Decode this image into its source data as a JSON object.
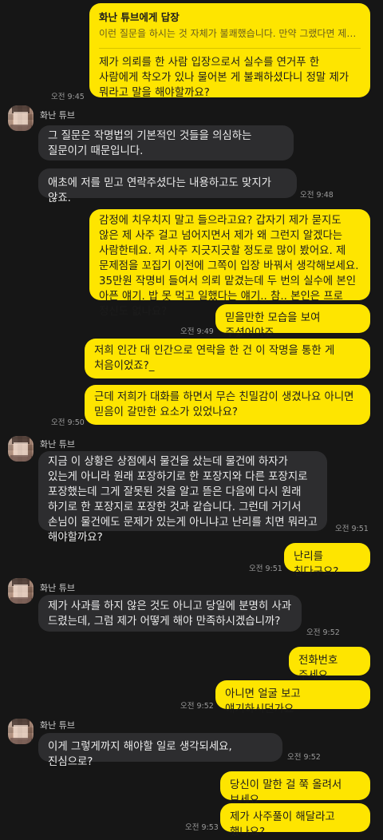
{
  "sender_name": "화난 튜브",
  "messages": [
    {
      "id": "m1",
      "side": "mine",
      "reply_title": "화난 튜브에게 답장",
      "reply_quote": "이런 질문을 하시는 것 자체가 불쾌했습니다. 만약 그랬다면 제쪽에서...",
      "text": "제가 의뢰를 한 사람 입장으로서 실수를 연거푸 한 사람에게 착오가 있나 물어본 게 불쾌하셨다니 정말 제가 뭐라고 말을 해야할까요?",
      "time": "오전 9:45"
    },
    {
      "id": "m2",
      "side": "theirs",
      "text": "그 질문은 작명법의 기본적인 것들을 의심하는 질문이기 때문입니다."
    },
    {
      "id": "m3",
      "side": "theirs",
      "text": "애초에 저를 믿고 연락주셨다는 내용하고도 맞지가 않죠.",
      "time": "오전 9:48"
    },
    {
      "id": "m4",
      "side": "mine",
      "text": "감정에 치우치지 말고 들으라고요? 갑자기 제가 묻지도 않은 제 사주 걸고 넘어지면서 제가 왜 그런지 알겠다는 사람한테요. 저 사주 지긋지긋할 정도로 많이 봤어요. 제 문제점을 꼬집기 이전에 그쪽이 입장 바꿔서 생각해보세요. 35만원 작명비 들여서 의뢰 맡겼는데 두 번의 실수에 본인 아픈 얘기. 밥 못 먹고 일했다는 얘기.. 참.. 본인은 프로 정신도 없나요?"
    },
    {
      "id": "m5",
      "side": "mine",
      "text": "믿을만한 모습을 보여 주셨어야죠",
      "time": "오전 9:49"
    },
    {
      "id": "m6",
      "side": "mine",
      "text": "저희 인간 대 인간으로 연락을 한 건 이 작명을 통한 게 처음이었죠?_"
    },
    {
      "id": "m7",
      "side": "mine",
      "text": "근데 저희가 대화를 하면서 무슨 친밀감이 생겼나요 아니면 믿음이 갈만한 요소가 있었나요?",
      "time": "오전 9:50"
    },
    {
      "id": "m8",
      "side": "theirs",
      "text": "지금 이 상황은 상점에서 물건을 샀는데 물건에 하자가 있는게 아니라 원래 포장하기로 한 포장지와 다른 포장지로 포장했는데 그게 잘못된 것을 알고 뜯은 다음에 다시 원래 하기로 한 포장지로 포장한 것과 같습니다. 그런데 거기서 손님이 물건에도 문제가 있는게 아니냐고 난리를 치면 뭐라고 해야할까요?",
      "time": "오전 9:51"
    },
    {
      "id": "m9",
      "side": "mine",
      "text": "난리를 친다구요?",
      "time": "오전 9:51"
    },
    {
      "id": "m10",
      "side": "theirs",
      "text": "제가 사과를 하지 않은 것도 아니고 당일에 분명히 사과 드렸는데, 그럼 제가 어떻게 해야 만족하시겠습니까?",
      "time": "오전 9:52"
    },
    {
      "id": "m11",
      "side": "mine",
      "text": "전화번호 주세요"
    },
    {
      "id": "m12",
      "side": "mine",
      "text": "아니면 얼굴 보고 얘기하시던가요",
      "time": "오전 9:52"
    },
    {
      "id": "m13",
      "side": "theirs",
      "text": "이게 그렇게까지 해야할 일로 생각되세요, 진심으로?",
      "time": "오전 9:52"
    },
    {
      "id": "m14",
      "side": "mine",
      "text": "당신이 말한 걸 쭉 올려서 보세요"
    },
    {
      "id": "m15",
      "side": "mine",
      "text": "제가 사주풀이 해달라고 했나요?",
      "time": "오전 9:53"
    }
  ],
  "colors": {
    "mine": "#fee500",
    "theirs": "#2d2d2f",
    "background": "#161616"
  }
}
